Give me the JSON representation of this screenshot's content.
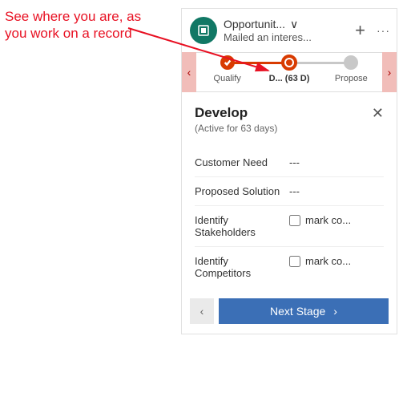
{
  "annotation": "See where you are, as you work on a record",
  "header": {
    "title": "Opportunit...",
    "subtitle": "Mailed an interes..."
  },
  "stages": {
    "prev": "‹",
    "next": "›",
    "items": [
      {
        "label": "Qualify",
        "state": "completed"
      },
      {
        "label": "D...   (63 D)",
        "state": "current"
      },
      {
        "label": "Propose",
        "state": "future"
      }
    ]
  },
  "flyout": {
    "title": "Develop",
    "subtitle": "(Active for 63 days)",
    "fields": [
      {
        "label": "Customer Need",
        "type": "text",
        "value": "---"
      },
      {
        "label": "Proposed Solution",
        "type": "text",
        "value": "---"
      },
      {
        "label": "Identify Stakeholders",
        "type": "check",
        "checklabel": "mark co..."
      },
      {
        "label": "Identify Competitors",
        "type": "check",
        "checklabel": "mark co..."
      }
    ]
  },
  "footer": {
    "back": "‹",
    "next_label": "Next Stage",
    "next_chevron": "›"
  }
}
